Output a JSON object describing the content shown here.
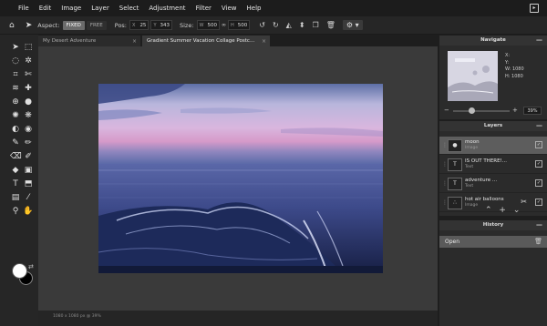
{
  "menu": {
    "items": [
      "File",
      "Edit",
      "Image",
      "Layer",
      "Select",
      "Adjustment",
      "Filter",
      "View",
      "Help"
    ]
  },
  "toolbar": {
    "aspect_label": "Aspect:",
    "aspect_fixed": "FIXED",
    "aspect_free": "FREE",
    "pos_label": "Pos:",
    "pos_x_key": "X",
    "pos_x": "25",
    "pos_y_key": "Y",
    "pos_y": "343",
    "size_label": "Size:",
    "size_w_key": "W",
    "size_w": "500",
    "size_h_key": "H",
    "size_h": "500"
  },
  "tabs": [
    {
      "label": "My Desert Adventure",
      "close": "×"
    },
    {
      "label": "Gradient Summer Vacation Collage Postc...",
      "close": "×"
    }
  ],
  "status": {
    "text": "1080 x 1080 px @ 39%"
  },
  "navigate": {
    "title": "Navigate",
    "x_label": "X:",
    "y_label": "Y:",
    "w_label": "W:",
    "w_value": "1080",
    "h_label": "H:",
    "h_value": "1080",
    "zoom": "39%",
    "zoom_fraction": 0.3,
    "minimize": "—"
  },
  "layers": {
    "title": "Layers",
    "minimize": "—",
    "items": [
      {
        "name": "moon",
        "type": "Image",
        "thumb": "●"
      },
      {
        "name": "IS OUT THERE!...",
        "type": "Text",
        "thumb": "T"
      },
      {
        "name": "adventure ...",
        "type": "Text",
        "thumb": "T"
      },
      {
        "name": "hot air balloons",
        "type": "Image",
        "thumb": "∴"
      }
    ]
  },
  "history": {
    "title": "History",
    "minimize": "—",
    "items": [
      {
        "label": "Open"
      }
    ]
  },
  "colors": {
    "fg": "#ffffff",
    "bg": "#000000",
    "panel": "#2b2b2b",
    "canvas": "#3a3a3a"
  }
}
